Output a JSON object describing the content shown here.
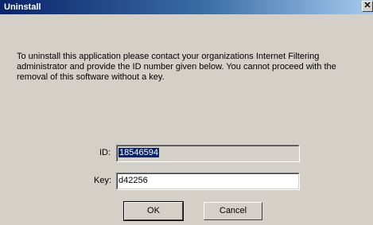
{
  "window": {
    "title": "Uninstall",
    "close_glyph": "✕"
  },
  "message": "To uninstall this application please contact your organizations Internet Filtering administrator and provide the ID number given below. You cannot proceed with the removal of this software without a key.",
  "form": {
    "id_label": "ID:",
    "id_value": "18546594",
    "key_label": "Key:",
    "key_value": "d42256"
  },
  "buttons": {
    "ok": "OK",
    "cancel": "Cancel"
  }
}
